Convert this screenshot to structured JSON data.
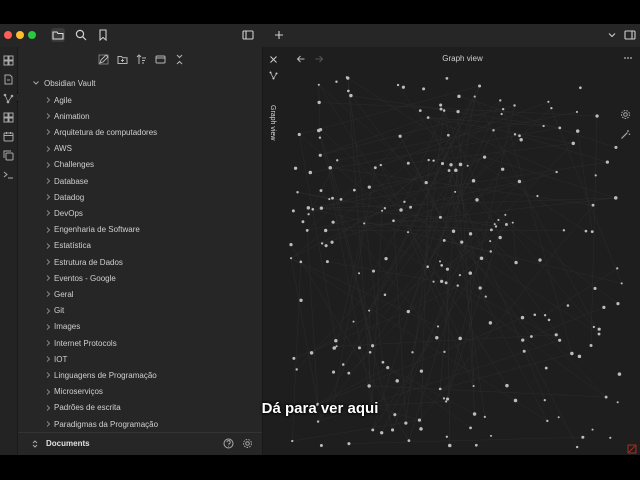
{
  "sidebar": {
    "vault_name": "Obsidian Vault",
    "folders": [
      "Agile",
      "Animation",
      "Arquitetura de computadores",
      "AWS",
      "Challenges",
      "Database",
      "Datadog",
      "DevOps",
      "Engenharia de Software",
      "Estatística",
      "Estrutura de Dados",
      "Eventos - Google",
      "Geral",
      "Git",
      "Images",
      "Internet Protocols",
      "IOT",
      "Linguagens de Programação",
      "Microserviços",
      "Padrões de escrita",
      "Paradigmas da Programação"
    ],
    "bottom_label": "Documents"
  },
  "graph_tab": {
    "vertical_label": "Graph view",
    "title": "Graph view"
  },
  "caption": "Dá para ver aqui",
  "colors": {
    "window_bg": "#1e1e1e",
    "sidebar_bg": "#262626",
    "node": "#bdbdbd",
    "traffic_red": "#ff5f57",
    "traffic_yellow": "#febc2e",
    "traffic_green": "#28c840"
  },
  "icons": [
    "folder-icon",
    "search-icon",
    "bookmark-icon",
    "sidebar-toggle-icon",
    "plus-icon",
    "chevron-down-icon",
    "layout-icon",
    "files-icon",
    "graph-icon",
    "canvas-icon",
    "calendar-icon",
    "copy-icon",
    "terminal-icon",
    "new-note-icon",
    "new-folder-icon",
    "sort-icon",
    "collapse-icon",
    "close-icon",
    "help-icon",
    "gear-icon",
    "back-arrow-icon",
    "forward-arrow-icon",
    "more-icon",
    "magic-wand-icon"
  ]
}
